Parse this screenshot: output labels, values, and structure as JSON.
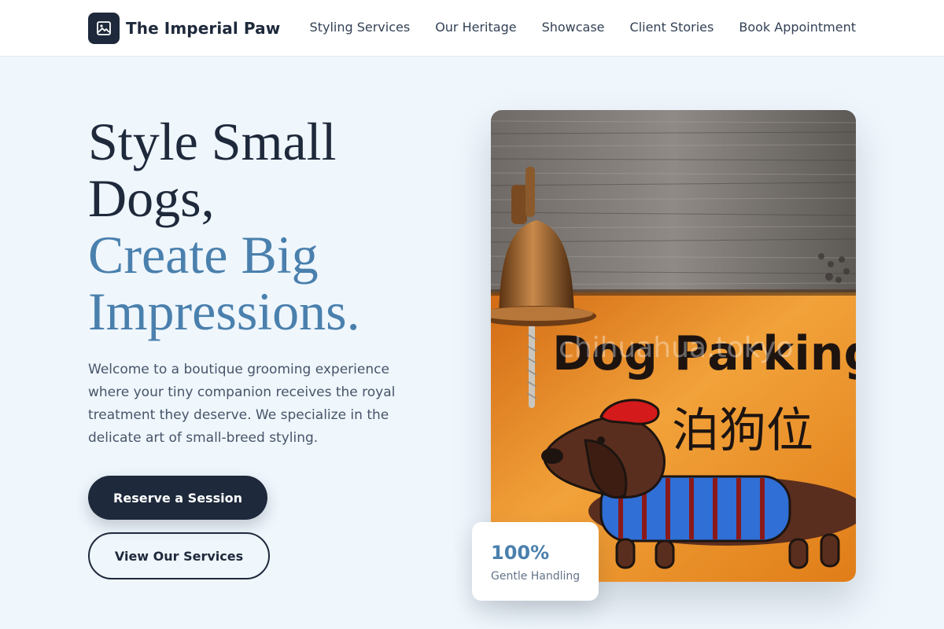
{
  "header": {
    "brand_name": "The Imperial Paw",
    "logo_icon": "image-icon",
    "nav": [
      {
        "label": "Styling Services"
      },
      {
        "label": "Our Heritage"
      },
      {
        "label": "Showcase"
      },
      {
        "label": "Client Stories"
      },
      {
        "label": "Book Appointment"
      }
    ]
  },
  "hero": {
    "headline_line1": "Style Small",
    "headline_line2": "Dogs,",
    "headline_line3": "Create Big",
    "headline_line4": "Impressions.",
    "intro": "Welcome to a boutique grooming experience where your tiny companion receives the royal treatment they deserve. We specialize in the delicate art of small-breed styling.",
    "primary_button": "Reserve a Session",
    "secondary_button": "View Our Services",
    "image": {
      "sign_text": "Dog Parking",
      "sign_chinese": "泊狗位",
      "watermark": "chihuahua.tokyo"
    },
    "stat": {
      "value": "100%",
      "label": "Gentle Handling"
    }
  },
  "colors": {
    "background": "#eff6fc",
    "primary": "#1e293b",
    "accent": "#4a80ad"
  }
}
